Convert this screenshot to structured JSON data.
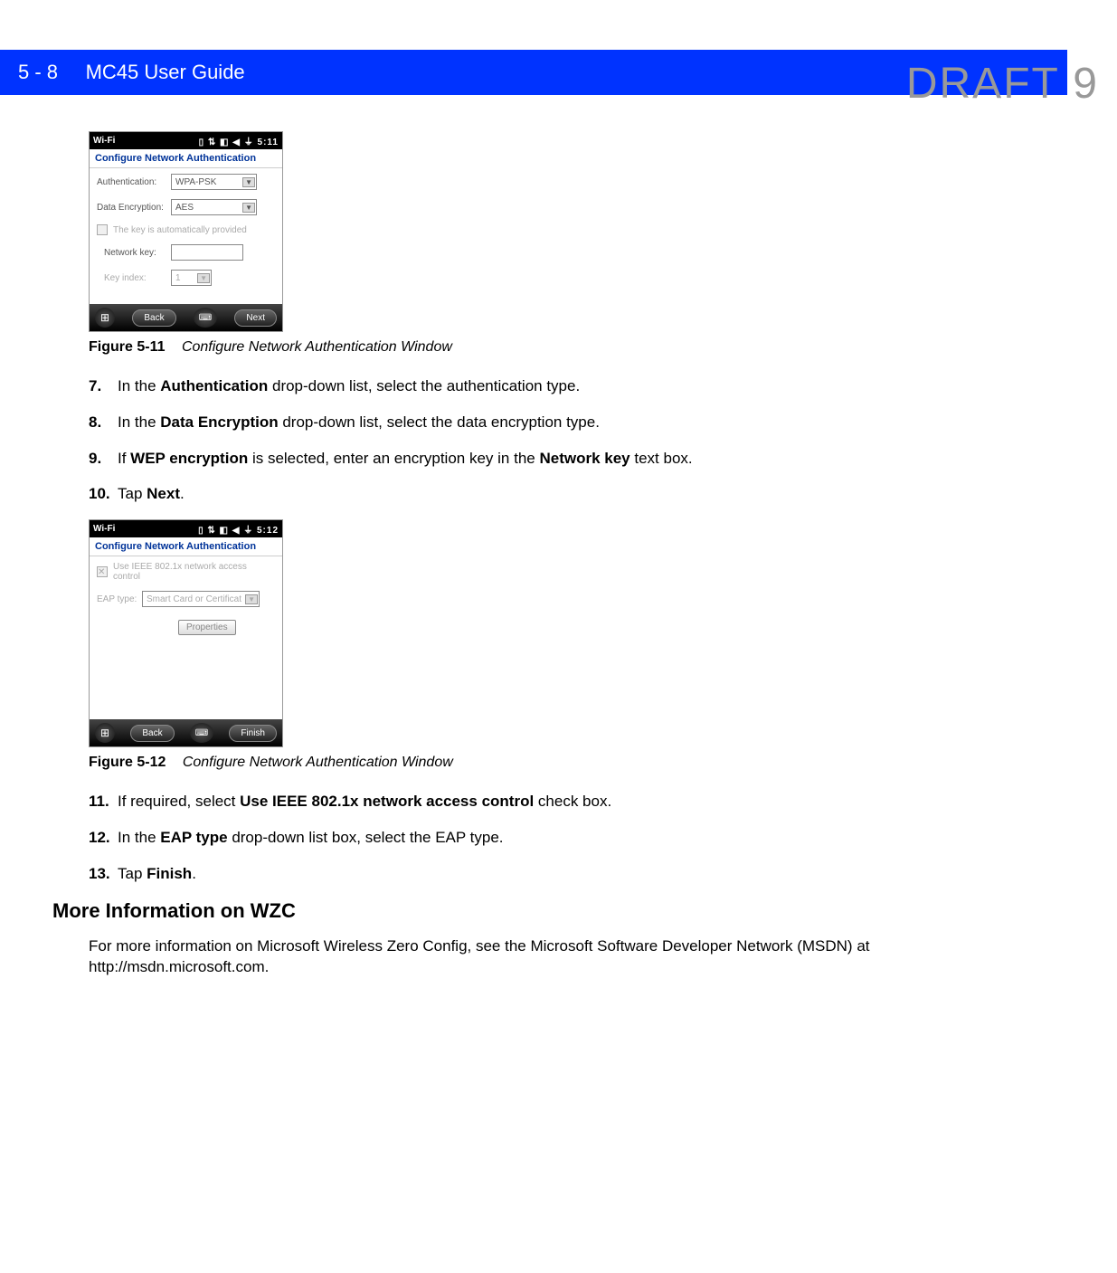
{
  "watermark": "DRAFT 9",
  "header": {
    "page_ref": "5 - 8",
    "title": "MC45 User Guide"
  },
  "screenshot1": {
    "top_title": "Wi-Fi",
    "top_time": "5:11",
    "window_title": "Configure Network Authentication",
    "auth_label": "Authentication:",
    "auth_value": "WPA-PSK",
    "enc_label": "Data Encryption:",
    "enc_value": "AES",
    "autokey_label": "The key is automatically provided",
    "netkey_label": "Network key:",
    "netkey_value": "",
    "keyidx_label": "Key index:",
    "keyidx_value": "1",
    "back_btn": "Back",
    "next_btn": "Next"
  },
  "fig1": {
    "num": "Figure 5-11",
    "title": "Configure Network Authentication Window"
  },
  "steps_a": {
    "n7": "7.",
    "t7_pre": "In the ",
    "t7_b": "Authentication",
    "t7_post": " drop-down list, select the authentication type.",
    "n8": "8.",
    "t8_pre": "In the ",
    "t8_b": "Data Encryption",
    "t8_post": " drop-down list, select the data encryption type.",
    "n9": "9.",
    "t9_pre": "If ",
    "t9_b1": "WEP encryption",
    "t9_mid": " is selected, enter an encryption key in the ",
    "t9_b2": "Network key",
    "t9_post": " text box.",
    "n10": "10.",
    "t10_pre": "Tap ",
    "t10_b": "Next",
    "t10_post": "."
  },
  "screenshot2": {
    "top_title": "Wi-Fi",
    "top_time": "5:12",
    "window_title": "Configure Network Authentication",
    "ieee_label": "Use IEEE 802.1x network access control",
    "eap_label": "EAP type:",
    "eap_value": "Smart Card or Certificat",
    "props_btn": "Properties",
    "back_btn": "Back",
    "finish_btn": "Finish"
  },
  "fig2": {
    "num": "Figure 5-12",
    "title": "Configure Network Authentication Window"
  },
  "steps_b": {
    "n11": "11.",
    "t11_pre": "If required, select ",
    "t11_b": "Use IEEE 802.1x network access control",
    "t11_post": " check box.",
    "n12": "12.",
    "t12_pre": "In the ",
    "t12_b": "EAP type",
    "t12_post": " drop-down list box, select the EAP type.",
    "n13": "13.",
    "t13_pre": "Tap ",
    "t13_b": "Finish",
    "t13_post": "."
  },
  "section_heading": "More Information on WZC",
  "body_text": "For more information on Microsoft Wireless Zero Config, see the Microsoft Software Developer Network (MSDN) at http://msdn.microsoft.com."
}
